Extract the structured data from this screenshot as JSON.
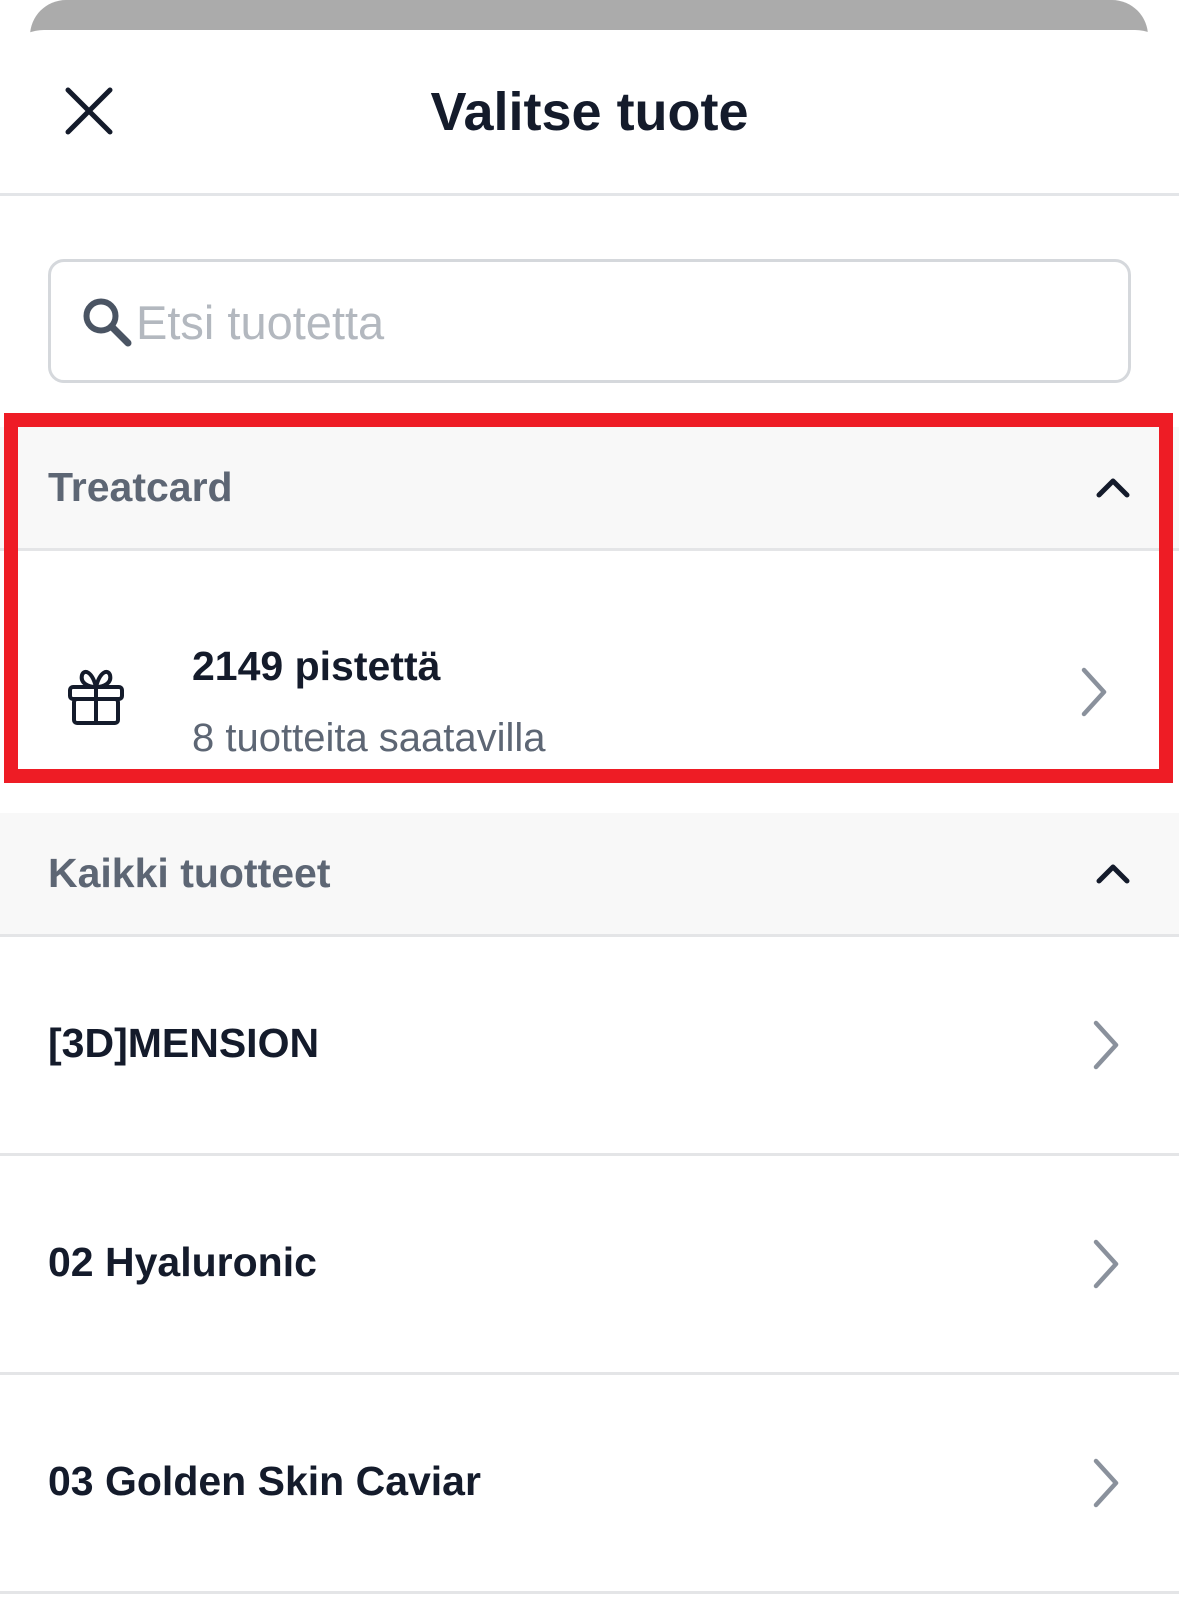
{
  "header": {
    "title": "Valitse tuote",
    "close_icon": "close-icon"
  },
  "search": {
    "placeholder": "Etsi tuotetta",
    "value": "",
    "icon": "search-icon"
  },
  "sections": {
    "treatcard": {
      "title": "Treatcard",
      "item": {
        "points": "2149 pistettä",
        "subtitle": "8 tuotteita saatavilla",
        "icon": "gift-icon"
      }
    },
    "all_products": {
      "title": "Kaikki tuotteet",
      "items": [
        {
          "label": "[3D]MENSION"
        },
        {
          "label": "02 Hyaluronic"
        },
        {
          "label": "03 Golden Skin Caviar"
        }
      ]
    }
  },
  "colors": {
    "highlight": "#ee1c25",
    "text_primary": "#141b2b",
    "text_secondary": "#5d6674",
    "section_bg": "#f8f8f8",
    "divider": "#e4e5e7"
  }
}
